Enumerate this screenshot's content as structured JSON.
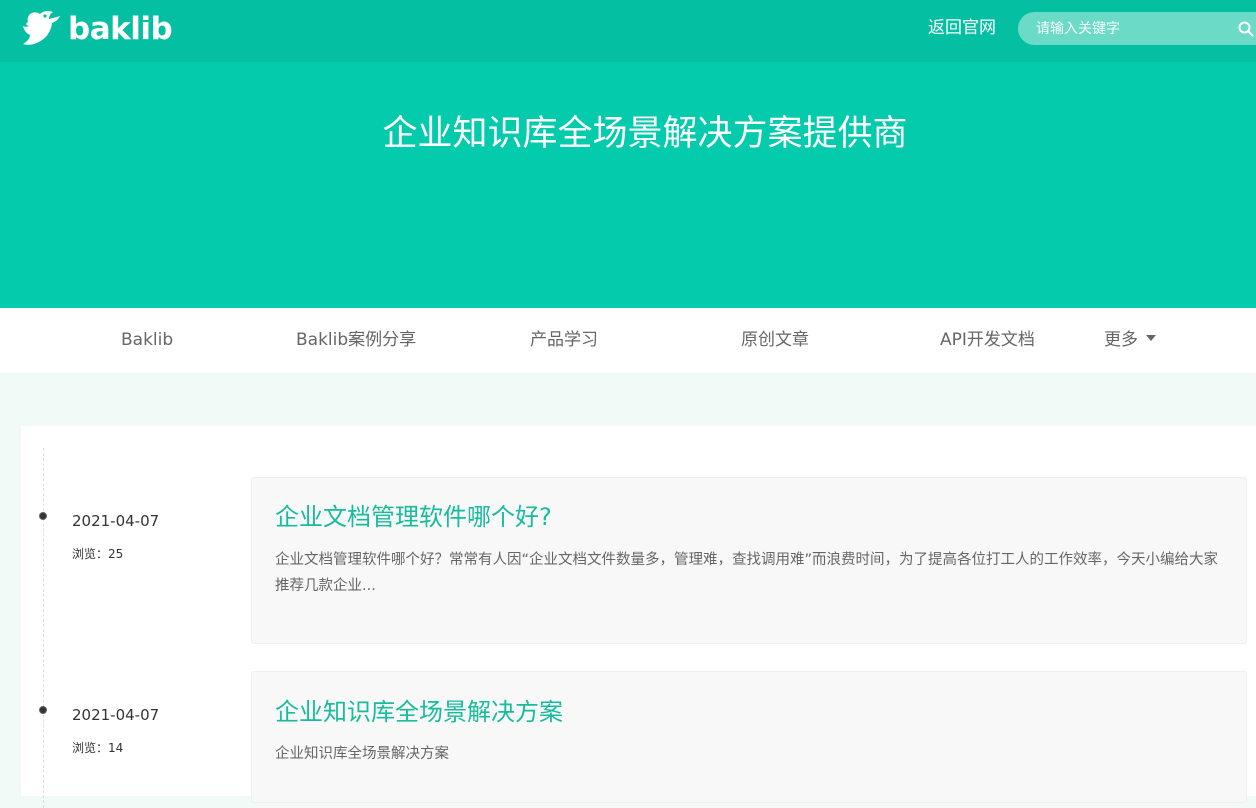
{
  "header": {
    "logo_text": "baklib",
    "back_link": "返回官网",
    "search_placeholder": "请输入关键字"
  },
  "hero": {
    "title": "企业知识库全场景解决方案提供商"
  },
  "nav": {
    "items": [
      {
        "label": "Baklib"
      },
      {
        "label": "Baklib案例分享"
      },
      {
        "label": "产品学习"
      },
      {
        "label": "原创文章"
      },
      {
        "label": "API开发文档"
      },
      {
        "label": "更多"
      }
    ]
  },
  "entries": [
    {
      "date": "2021-04-07",
      "views": "浏览：25",
      "title": "企业文档管理软件哪个好?",
      "desc": "企业文档管理软件哪个好？常常有人因“企业文档文件数量多，管理难，查找调用难”而浪费时间，为了提高各位打工人的工作效率，今天小编给大家推荐几款企业..."
    },
    {
      "date": "2021-04-07",
      "views": "浏览：14",
      "title": "企业知识库全场景解决方案",
      "desc": "企业知识库全场景解决方案"
    }
  ],
  "colors": {
    "brand": "#05bfa2",
    "hero": "#03cbab",
    "link": "#17bc9c"
  }
}
